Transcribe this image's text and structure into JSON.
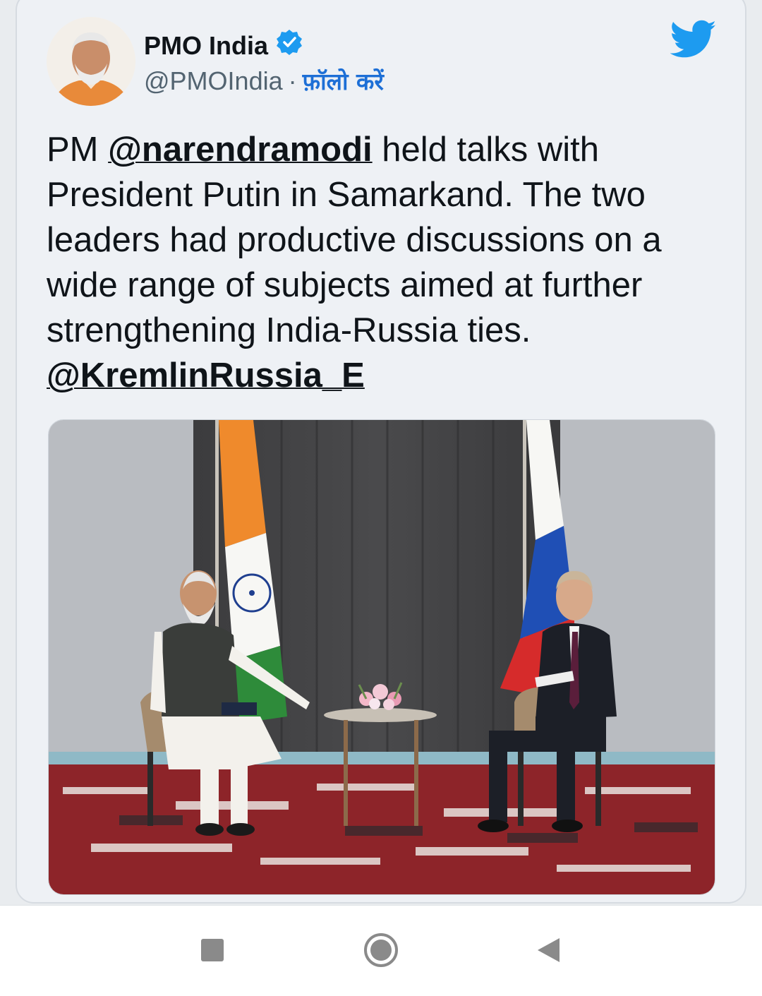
{
  "account": {
    "name": "PMO India",
    "handle": "@PMOIndia",
    "separator": "·",
    "follow_label": "फ़ॉलो करें",
    "verified_icon": "verified-badge-icon",
    "platform_icon": "twitter-bird-icon"
  },
  "tweet": {
    "prefix": "PM ",
    "mention1": "@narendramodi",
    "body": " held talks with President Putin in Samarkand. The two leaders had productive discussions on a wide range of subjects aimed at further strengthening India-Russia ties.",
    "mention2": "@KremlinRussia_E"
  },
  "navbar": {
    "recents_icon": "square-recents-icon",
    "home_icon": "circle-home-icon",
    "back_icon": "triangle-back-icon"
  },
  "colors": {
    "accent": "#1d9bf0",
    "link": "#1d6fd6",
    "text": "#0f1419",
    "muted": "#536471"
  }
}
